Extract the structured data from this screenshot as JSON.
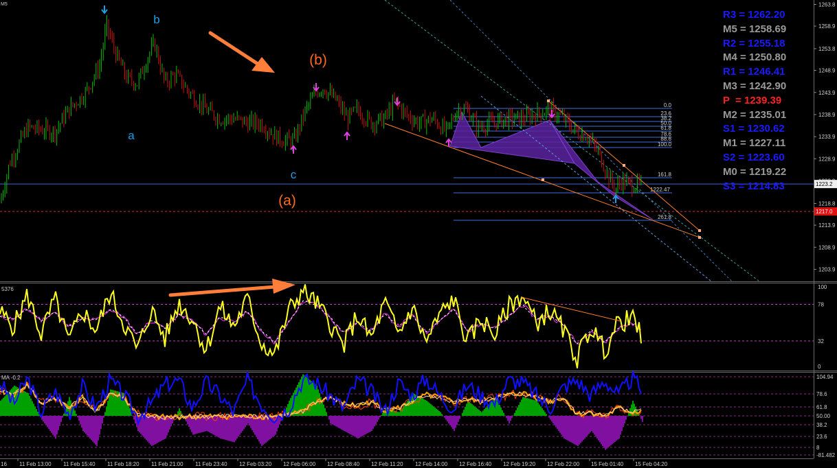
{
  "colors": {
    "background": "#000000",
    "bull_candle": "#00c000",
    "bear_candle": "#d01010",
    "price_line": "#3b66d8",
    "stop_line": "#d03030",
    "fibo": "#3f6fe0",
    "harmonic_fill": "#5a22a0",
    "trend_line": "#ff7f2a",
    "wave_label_blue": "#1e9fe8",
    "wave_label_orange": "#ff6a20",
    "arrow_magenta": "#e040e0",
    "stochastic_main": "#ffff20",
    "stochastic_signal": "#ff30ff",
    "indicator_blue": "#1010ff",
    "indicator_orange": "#ffa000",
    "hist_green": "#00a000",
    "hist_purple": "#8010a0",
    "pivot_blue": "#1a1aff",
    "pivot_gray": "#9a9a9a",
    "pivot_red": "#ff2020"
  },
  "main_chart": {
    "corner_label": "M5",
    "price_axis_ticks": [
      "1263.8",
      "1258.9",
      "1253.8",
      "1248.9",
      "1243.9",
      "1238.9",
      "1233.9",
      "1228.9",
      "1223.9",
      "1218.8",
      "1213.9",
      "1208.9",
      "1203.9"
    ],
    "current_price_tag": "1223.2",
    "stop_price_tag": "1217.0",
    "wave_labels": [
      {
        "text": "a",
        "style": "blue"
      },
      {
        "text": "b",
        "style": "blue"
      },
      {
        "text": "c",
        "style": "blue"
      },
      {
        "text": "(a)",
        "style": "orange"
      },
      {
        "text": "(b)",
        "style": "orange"
      }
    ],
    "fibo_levels": [
      "0.0",
      "23.6",
      "38.2",
      "50.0",
      "61.8",
      "78.6",
      "88.6",
      "100.0",
      "161.8",
      "261.8"
    ],
    "fibo_price_label": "1222.47"
  },
  "pivots": [
    {
      "label": "R3",
      "value": "1262.20",
      "style": "blue"
    },
    {
      "label": "M5",
      "value": "1258.69",
      "style": "gray"
    },
    {
      "label": "R2",
      "value": "1255.18",
      "style": "blue"
    },
    {
      "label": "M4",
      "value": "1250.80",
      "style": "gray"
    },
    {
      "label": "R1",
      "value": "1246.41",
      "style": "blue"
    },
    {
      "label": "M3",
      "value": "1242.90",
      "style": "gray"
    },
    {
      "label": "P",
      "value": "1239.39",
      "style": "red"
    },
    {
      "label": "M2",
      "value": "1235.01",
      "style": "gray"
    },
    {
      "label": "S1",
      "value": "1230.62",
      "style": "blue"
    },
    {
      "label": "M1",
      "value": "1227.11",
      "style": "gray"
    },
    {
      "label": "S2",
      "value": "1223.60",
      "style": "blue"
    },
    {
      "label": "M0",
      "value": "1219.22",
      "style": "gray"
    },
    {
      "label": "S3",
      "value": "1214.83",
      "style": "blue"
    }
  ],
  "stochastic": {
    "corner_label": "5376",
    "axis_ticks": [
      "100",
      "78",
      "32",
      "0"
    ]
  },
  "lower_indicator": {
    "corner_label": "MA -0.2",
    "axis_ticks": [
      "104.94",
      "78.6",
      "61.8",
      "50.00",
      "38.2",
      "23.6",
      "8",
      "-81.482"
    ]
  },
  "time_axis": [
    "11 Feb 13:00",
    "11 Feb 15:40",
    "11 Feb 18:20",
    "11 Feb 21:00",
    "11 Feb 23:40",
    "12 Feb 03:20",
    "12 Feb 06:00",
    "12 Feb 08:40",
    "12 Feb 11:20",
    "12 Feb 14:00",
    "12 Feb 16:40",
    "12 Feb 19:20",
    "12 Feb 22:00",
    "15 Feb 01:40",
    "15 Feb 04:20"
  ],
  "time_axis_left_label": "16",
  "chart_data": [
    {
      "type": "candlestick",
      "title": "",
      "ylim": [
        1201.5,
        1264.5
      ],
      "pivot_lines": [
        1223.2,
        1217.0
      ],
      "close_anchors": [
        [
          0,
          1219
        ],
        [
          14,
          1228
        ],
        [
          40,
          1236
        ],
        [
          80,
          1235
        ],
        [
          100,
          1240
        ],
        [
          125,
          1244
        ],
        [
          145,
          1250
        ],
        [
          155,
          1259
        ],
        [
          170,
          1252
        ],
        [
          185,
          1247
        ],
        [
          200,
          1246
        ],
        [
          215,
          1252
        ],
        [
          225,
          1255
        ],
        [
          240,
          1246
        ],
        [
          255,
          1248
        ],
        [
          275,
          1244
        ],
        [
          300,
          1240
        ],
        [
          320,
          1238
        ],
        [
          340,
          1238
        ],
        [
          360,
          1237
        ],
        [
          380,
          1237
        ],
        [
          400,
          1234
        ],
        [
          415,
          1233
        ],
        [
          428,
          1233
        ],
        [
          445,
          1240
        ],
        [
          460,
          1244
        ],
        [
          470,
          1245
        ],
        [
          490,
          1242
        ],
        [
          505,
          1238
        ],
        [
          520,
          1240
        ],
        [
          540,
          1237
        ],
        [
          560,
          1238
        ],
        [
          575,
          1242
        ],
        [
          590,
          1239
        ],
        [
          610,
          1237
        ],
        [
          630,
          1238
        ],
        [
          650,
          1235
        ],
        [
          665,
          1240
        ],
        [
          680,
          1240
        ],
        [
          695,
          1236
        ],
        [
          715,
          1237
        ],
        [
          740,
          1238
        ],
        [
          760,
          1238
        ],
        [
          780,
          1239
        ],
        [
          800,
          1240
        ],
        [
          820,
          1238
        ],
        [
          838,
          1235
        ],
        [
          855,
          1234
        ],
        [
          872,
          1230
        ],
        [
          885,
          1225
        ],
        [
          895,
          1222
        ],
        [
          905,
          1224
        ],
        [
          920,
          1223
        ],
        [
          935,
          1223
        ]
      ]
    },
    {
      "type": "line",
      "title": "",
      "ylim": [
        0,
        100
      ],
      "x": [
        0,
        20,
        40,
        60,
        80,
        100,
        120,
        140,
        160,
        180,
        200,
        220,
        240,
        260,
        280,
        300,
        320,
        340,
        360,
        380,
        400,
        420,
        440,
        460,
        480,
        500,
        520,
        540,
        560,
        580,
        600,
        620,
        640,
        660,
        680,
        700,
        720,
        740,
        760,
        780,
        800,
        820,
        840,
        860,
        880,
        900,
        920,
        935
      ],
      "series": [
        {
          "values": [
            68,
            50,
            90,
            40,
            85,
            30,
            70,
            45,
            92,
            55,
            20,
            72,
            35,
            80,
            60,
            20,
            75,
            50,
            85,
            30,
            15,
            70,
            95,
            80,
            55,
            25,
            65,
            35,
            80,
            40,
            75,
            30,
            65,
            85,
            30,
            60,
            40,
            75,
            90,
            55,
            70,
            45,
            10,
            50,
            20,
            55,
            60,
            35
          ]
        },
        {
          "values": [
            62,
            60,
            72,
            58,
            68,
            50,
            60,
            58,
            72,
            62,
            40,
            58,
            48,
            65,
            58,
            40,
            62,
            55,
            70,
            45,
            30,
            55,
            82,
            78,
            62,
            42,
            55,
            45,
            66,
            50,
            64,
            42,
            58,
            72,
            44,
            55,
            48,
            62,
            78,
            60,
            64,
            52,
            28,
            46,
            30,
            48,
            55,
            42
          ]
        }
      ]
    },
    {
      "type": "line",
      "title": "",
      "ylim": [
        -81.482,
        104.94
      ],
      "x": [
        0,
        20,
        40,
        60,
        80,
        100,
        120,
        140,
        160,
        180,
        200,
        220,
        240,
        260,
        280,
        300,
        320,
        340,
        360,
        380,
        400,
        420,
        440,
        460,
        480,
        500,
        520,
        540,
        560,
        580,
        600,
        620,
        640,
        660,
        680,
        700,
        720,
        740,
        760,
        780,
        800,
        820,
        840,
        860,
        880,
        900,
        920,
        935
      ],
      "series": [
        {
          "values": [
            90,
            40,
            100,
            20,
            70,
            15,
            80,
            30,
            95,
            60,
            10,
            40,
            85,
            95,
            30,
            90,
            60,
            20,
            95,
            40,
            10,
            30,
            95,
            90,
            60,
            30,
            95,
            70,
            20,
            90,
            60,
            100,
            60,
            30,
            85,
            60,
            40,
            95,
            90,
            60,
            30,
            80,
            95,
            60,
            95,
            60,
            100,
            70
          ]
        },
        {
          "values": [
            70,
            60,
            85,
            40,
            55,
            30,
            55,
            20,
            65,
            55,
            15,
            10,
            8,
            10,
            10,
            10,
            10,
            12,
            10,
            10,
            12,
            15,
            20,
            45,
            55,
            40,
            35,
            45,
            25,
            30,
            45,
            60,
            55,
            45,
            50,
            45,
            55,
            60,
            65,
            55,
            45,
            55,
            15,
            20,
            10,
            30,
            20,
            25
          ]
        }
      ],
      "histogram": [
        20,
        40,
        30,
        -5,
        -30,
        25,
        -20,
        -40,
        35,
        30,
        -20,
        -40,
        -30,
        10,
        -25,
        -20,
        -30,
        -35,
        -10,
        -40,
        -25,
        20,
        55,
        40,
        -10,
        -20,
        -30,
        -20,
        10,
        5,
        30,
        20,
        5,
        -20,
        20,
        5,
        25,
        -10,
        25,
        20,
        -5,
        -30,
        -40,
        -20,
        -45,
        -30,
        20,
        -10
      ]
    }
  ]
}
